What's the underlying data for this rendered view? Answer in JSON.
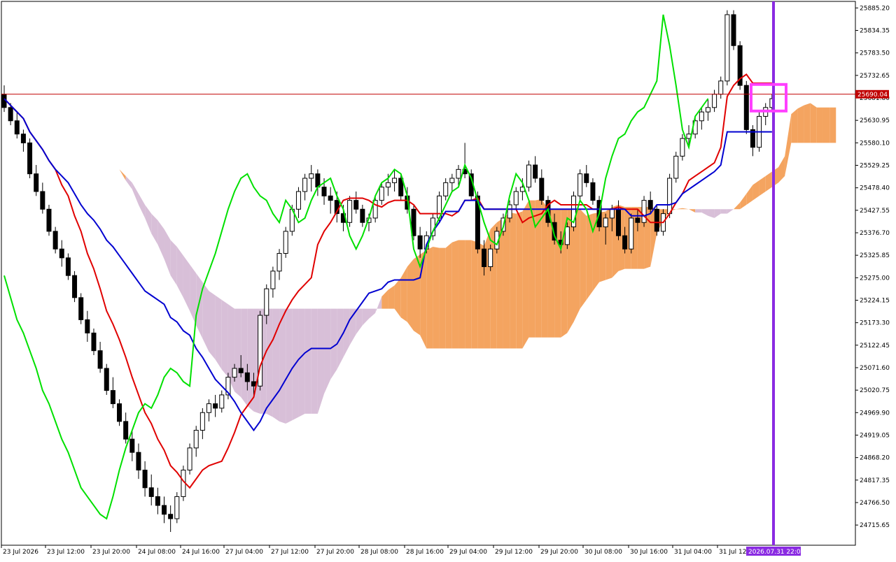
{
  "chart_data": {
    "type": "candlestick",
    "subtype": "ichimoku",
    "title": "",
    "xlabel": "",
    "ylabel": "",
    "ylim": [
      24670,
      25900
    ],
    "y_ticks": [
      "25885.20",
      "25834.35",
      "25783.50",
      "25732.65",
      "25681.80",
      "25630.95",
      "25580.10",
      "25529.25",
      "25478.40",
      "25427.55",
      "25376.70",
      "25325.85",
      "25275.00",
      "25224.15",
      "25173.30",
      "25122.45",
      "25071.60",
      "25020.75",
      "24969.90",
      "24919.05",
      "24868.20",
      "24817.35",
      "24766.50",
      "24715.65"
    ],
    "x_ticks": [
      "23 Jul 2026",
      "23 Jul 12:00",
      "23 Jul 20:00",
      "24 Jul 08:00",
      "24 Jul 16:00",
      "27 Jul 04:00",
      "27 Jul 12:00",
      "27 Jul 20:00",
      "28 Jul 08:00",
      "28 Jul 16:00",
      "29 Jul 04:00",
      "29 Jul 12:00",
      "29 Jul 20:00",
      "30 Jul 08:00",
      "30 Jul 16:00",
      "31 Jul 04:00",
      "31 Jul 12:"
    ],
    "current_price": "25690.04",
    "cursor_time": "2026.07.31 22:00",
    "candles": [
      [
        25690,
        25710,
        25650,
        25660
      ],
      [
        25660,
        25670,
        25620,
        25630
      ],
      [
        25630,
        25650,
        25590,
        25600
      ],
      [
        25600,
        25610,
        25560,
        25580
      ],
      [
        25580,
        25590,
        25500,
        25510
      ],
      [
        25510,
        25530,
        25460,
        25470
      ],
      [
        25470,
        25490,
        25420,
        25430
      ],
      [
        25430,
        25440,
        25370,
        25380
      ],
      [
        25380,
        25390,
        25330,
        25340
      ],
      [
        25340,
        25360,
        25300,
        25320
      ],
      [
        25320,
        25330,
        25270,
        25280
      ],
      [
        25280,
        25290,
        25220,
        25230
      ],
      [
        25230,
        25240,
        25170,
        25180
      ],
      [
        25180,
        25200,
        25130,
        25150
      ],
      [
        25150,
        25160,
        25100,
        25110
      ],
      [
        25110,
        25130,
        25060,
        25070
      ],
      [
        25070,
        25080,
        25010,
        25020
      ],
      [
        25020,
        25050,
        24980,
        24990
      ],
      [
        24990,
        25000,
        24940,
        24950
      ],
      [
        24950,
        24970,
        24900,
        24910
      ],
      [
        24910,
        24930,
        24860,
        24880
      ],
      [
        24880,
        24900,
        24820,
        24840
      ],
      [
        24840,
        24860,
        24780,
        24800
      ],
      [
        24800,
        24830,
        24760,
        24780
      ],
      [
        24780,
        24800,
        24740,
        24760
      ],
      [
        24760,
        24780,
        24720,
        24740
      ],
      [
        24740,
        24760,
        24700,
        24730
      ],
      [
        24730,
        24790,
        24720,
        24780
      ],
      [
        24780,
        24850,
        24770,
        24840
      ],
      [
        24840,
        24900,
        24830,
        24890
      ],
      [
        24890,
        24940,
        24870,
        24930
      ],
      [
        24930,
        24980,
        24910,
        24970
      ],
      [
        24970,
        25000,
        24950,
        24990
      ],
      [
        24990,
        25010,
        24960,
        24980
      ],
      [
        24980,
        25020,
        24970,
        25010
      ],
      [
        25010,
        25060,
        25000,
        25050
      ],
      [
        25050,
        25080,
        25040,
        25070
      ],
      [
        25070,
        25100,
        25050,
        25060
      ],
      [
        25060,
        25080,
        25020,
        25040
      ],
      [
        25040,
        25060,
        25010,
        25030
      ],
      [
        25030,
        25200,
        25020,
        25190
      ],
      [
        25190,
        25260,
        25170,
        25250
      ],
      [
        25250,
        25300,
        25230,
        25290
      ],
      [
        25290,
        25340,
        25270,
        25330
      ],
      [
        25330,
        25390,
        25320,
        25380
      ],
      [
        25380,
        25440,
        25370,
        25430
      ],
      [
        25430,
        25480,
        25410,
        25470
      ],
      [
        25470,
        25510,
        25450,
        25500
      ],
      [
        25500,
        25530,
        25470,
        25510
      ],
      [
        25510,
        25520,
        25460,
        25480
      ],
      [
        25480,
        25500,
        25440,
        25460
      ],
      [
        25460,
        25480,
        25420,
        25450
      ],
      [
        25450,
        25470,
        25400,
        25420
      ],
      [
        25420,
        25440,
        25380,
        25400
      ],
      [
        25400,
        25460,
        25390,
        25450
      ],
      [
        25450,
        25470,
        25420,
        25430
      ],
      [
        25430,
        25440,
        25390,
        25400
      ],
      [
        25400,
        25420,
        25380,
        25410
      ],
      [
        25410,
        25460,
        25400,
        25450
      ],
      [
        25450,
        25490,
        25440,
        25480
      ],
      [
        25480,
        25510,
        25460,
        25490
      ],
      [
        25490,
        25520,
        25470,
        25500
      ],
      [
        25500,
        25510,
        25450,
        25460
      ],
      [
        25460,
        25480,
        25420,
        25430
      ],
      [
        25430,
        25440,
        25360,
        25370
      ],
      [
        25370,
        25390,
        25320,
        25340
      ],
      [
        25340,
        25380,
        25330,
        25370
      ],
      [
        25370,
        25420,
        25360,
        25410
      ],
      [
        25410,
        25470,
        25400,
        25460
      ],
      [
        25460,
        25500,
        25450,
        25490
      ],
      [
        25490,
        25510,
        25470,
        25500
      ],
      [
        25500,
        25530,
        25480,
        25520
      ],
      [
        25520,
        25580,
        25500,
        25510
      ],
      [
        25510,
        25520,
        25450,
        25460
      ],
      [
        25460,
        25470,
        25330,
        25340
      ],
      [
        25340,
        25360,
        25280,
        25300
      ],
      [
        25300,
        25350,
        25290,
        25340
      ],
      [
        25340,
        25390,
        25330,
        25380
      ],
      [
        25380,
        25420,
        25370,
        25410
      ],
      [
        25410,
        25450,
        25400,
        25440
      ],
      [
        25440,
        25480,
        25430,
        25470
      ],
      [
        25470,
        25500,
        25450,
        25480
      ],
      [
        25480,
        25540,
        25470,
        25530
      ],
      [
        25530,
        25550,
        25490,
        25500
      ],
      [
        25500,
        25520,
        25440,
        25450
      ],
      [
        25450,
        25460,
        25390,
        25400
      ],
      [
        25400,
        25420,
        25350,
        25360
      ],
      [
        25360,
        25380,
        25330,
        25350
      ],
      [
        25350,
        25400,
        25340,
        25390
      ],
      [
        25390,
        25470,
        25380,
        25460
      ],
      [
        25460,
        25520,
        25450,
        25510
      ],
      [
        25510,
        25530,
        25480,
        25490
      ],
      [
        25490,
        25500,
        25440,
        25450
      ],
      [
        25450,
        25460,
        25380,
        25390
      ],
      [
        25390,
        25420,
        25350,
        25410
      ],
      [
        25410,
        25440,
        25380,
        25430
      ],
      [
        25430,
        25450,
        25360,
        25370
      ],
      [
        25370,
        25390,
        25330,
        25340
      ],
      [
        25340,
        25420,
        25330,
        25410
      ],
      [
        25410,
        25430,
        25380,
        25400
      ],
      [
        25400,
        25460,
        25390,
        25450
      ],
      [
        25450,
        25470,
        25420,
        25430
      ],
      [
        25430,
        25440,
        25370,
        25380
      ],
      [
        25380,
        25430,
        25370,
        25420
      ],
      [
        25420,
        25510,
        25410,
        25500
      ],
      [
        25500,
        25560,
        25490,
        25550
      ],
      [
        25550,
        25600,
        25540,
        25590
      ],
      [
        25590,
        25620,
        25570,
        25600
      ],
      [
        25600,
        25640,
        25590,
        25630
      ],
      [
        25630,
        25660,
        25610,
        25650
      ],
      [
        25650,
        25680,
        25630,
        25660
      ],
      [
        25660,
        25700,
        25650,
        25690
      ],
      [
        25690,
        25730,
        25680,
        25720
      ],
      [
        25720,
        25880,
        25710,
        25870
      ],
      [
        25870,
        25880,
        25790,
        25800
      ],
      [
        25800,
        25810,
        25700,
        25710
      ],
      [
        25710,
        25720,
        25600,
        25610
      ],
      [
        25610,
        25620,
        25550,
        25570
      ],
      [
        25570,
        25650,
        25560,
        25640
      ],
      [
        25640,
        25670,
        25620,
        25660
      ],
      [
        25660,
        25690,
        25650,
        25680
      ]
    ],
    "series": [
      {
        "name": "Tenkan-sen",
        "color": "#e00000"
      },
      {
        "name": "Kijun-sen",
        "color": "#0000d0"
      },
      {
        "name": "Chikou Span",
        "color": "#00e000"
      },
      {
        "name": "Senkou Span A",
        "color": "#f4a460"
      },
      {
        "name": "Senkou Span B",
        "color": "#d8bfd8"
      }
    ],
    "colors": {
      "bull_candle": "#ffffff",
      "bear_candle": "#000000",
      "marker": "#ff40ff",
      "vline": "#8a2be2",
      "price_line": "#c00000",
      "price_tag": "#c00000",
      "time_tag": "#8a2be2"
    },
    "grid": false
  }
}
